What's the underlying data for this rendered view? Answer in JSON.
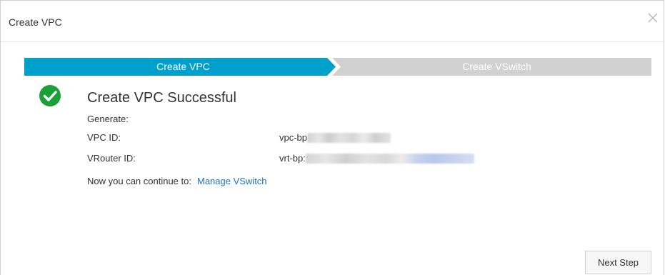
{
  "dialog": {
    "title": "Create VPC",
    "close_icon": "close-icon"
  },
  "steps": [
    {
      "label": "Create VPC",
      "state": "active",
      "color": "#00a0cc"
    },
    {
      "label": "Create VSwitch",
      "state": "inactive",
      "color": "#d1d1d1"
    }
  ],
  "result": {
    "icon": "check-circle-icon",
    "icon_color": "#1aa035",
    "title": "Create VPC Successful",
    "generate_label": "Generate:",
    "vpc_id_label": "VPC ID:",
    "vpc_id_value": "vpc-bp",
    "vrouter_id_label": "VRouter ID:",
    "vrouter_id_value": "vrt-bp:",
    "continue_text": "Now you can continue to:",
    "continue_link": "Manage VSwitch"
  },
  "footer": {
    "next_button": "Next Step"
  }
}
